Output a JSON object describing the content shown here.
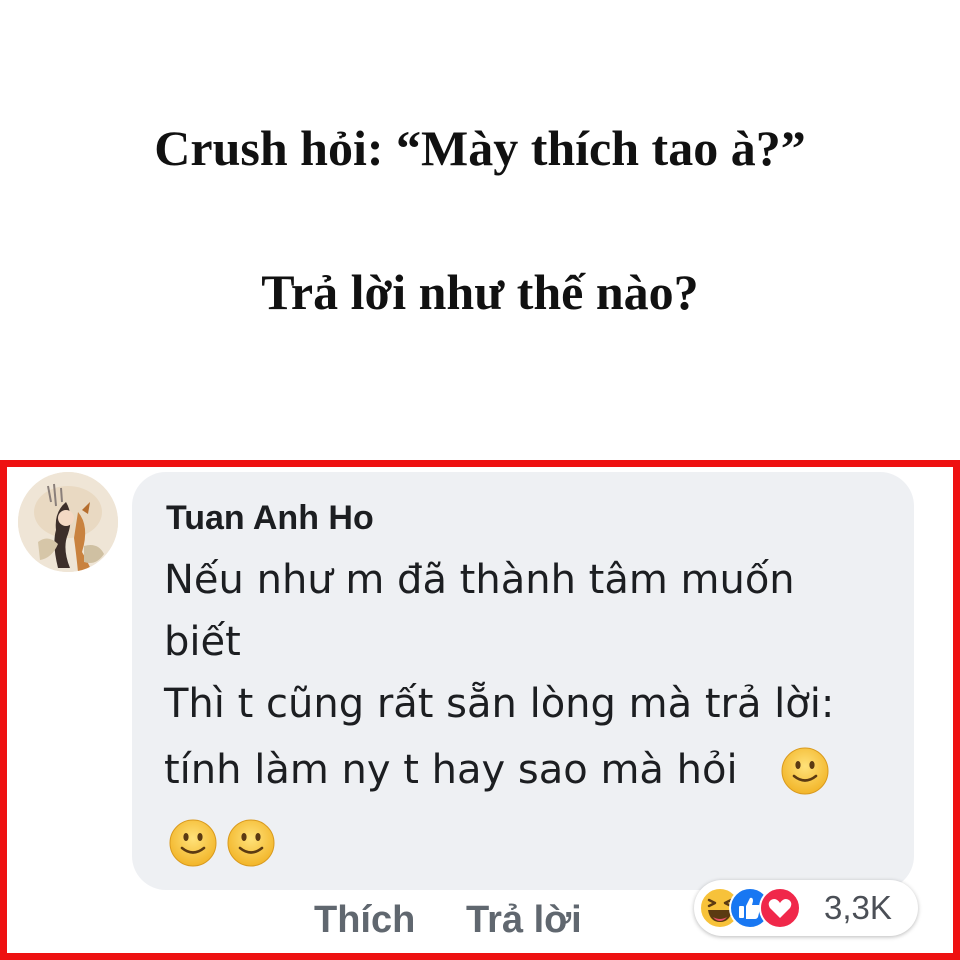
{
  "post": {
    "question_line": "Crush hỏi: “Mày thích tao à?”",
    "prompt_line": "Trả lời như thế nào?"
  },
  "comment": {
    "author": "Tuan Anh Ho",
    "lines": [
      "Nếu như m đã thành tâm muốn",
      "biết",
      "Thì t cũng rất sẵn lòng mà trả lời:",
      "tính làm ny t hay sao mà hỏi"
    ],
    "emojis": [
      "slightly-smiling-face",
      "slightly-smiling-face",
      "slightly-smiling-face"
    ],
    "actions": {
      "like": "Thích",
      "reply": "Trả lời"
    },
    "reactions": {
      "icons": [
        "haha-reaction-icon",
        "like-reaction-icon",
        "love-reaction-icon"
      ],
      "count": "3,3K"
    }
  },
  "colors": {
    "frame_border": "#ee1111",
    "bubble_bg": "#eef0f3",
    "like_blue": "#1877f2",
    "love_red": "#f0284a",
    "emoji_yellow": "#f7c23a"
  }
}
